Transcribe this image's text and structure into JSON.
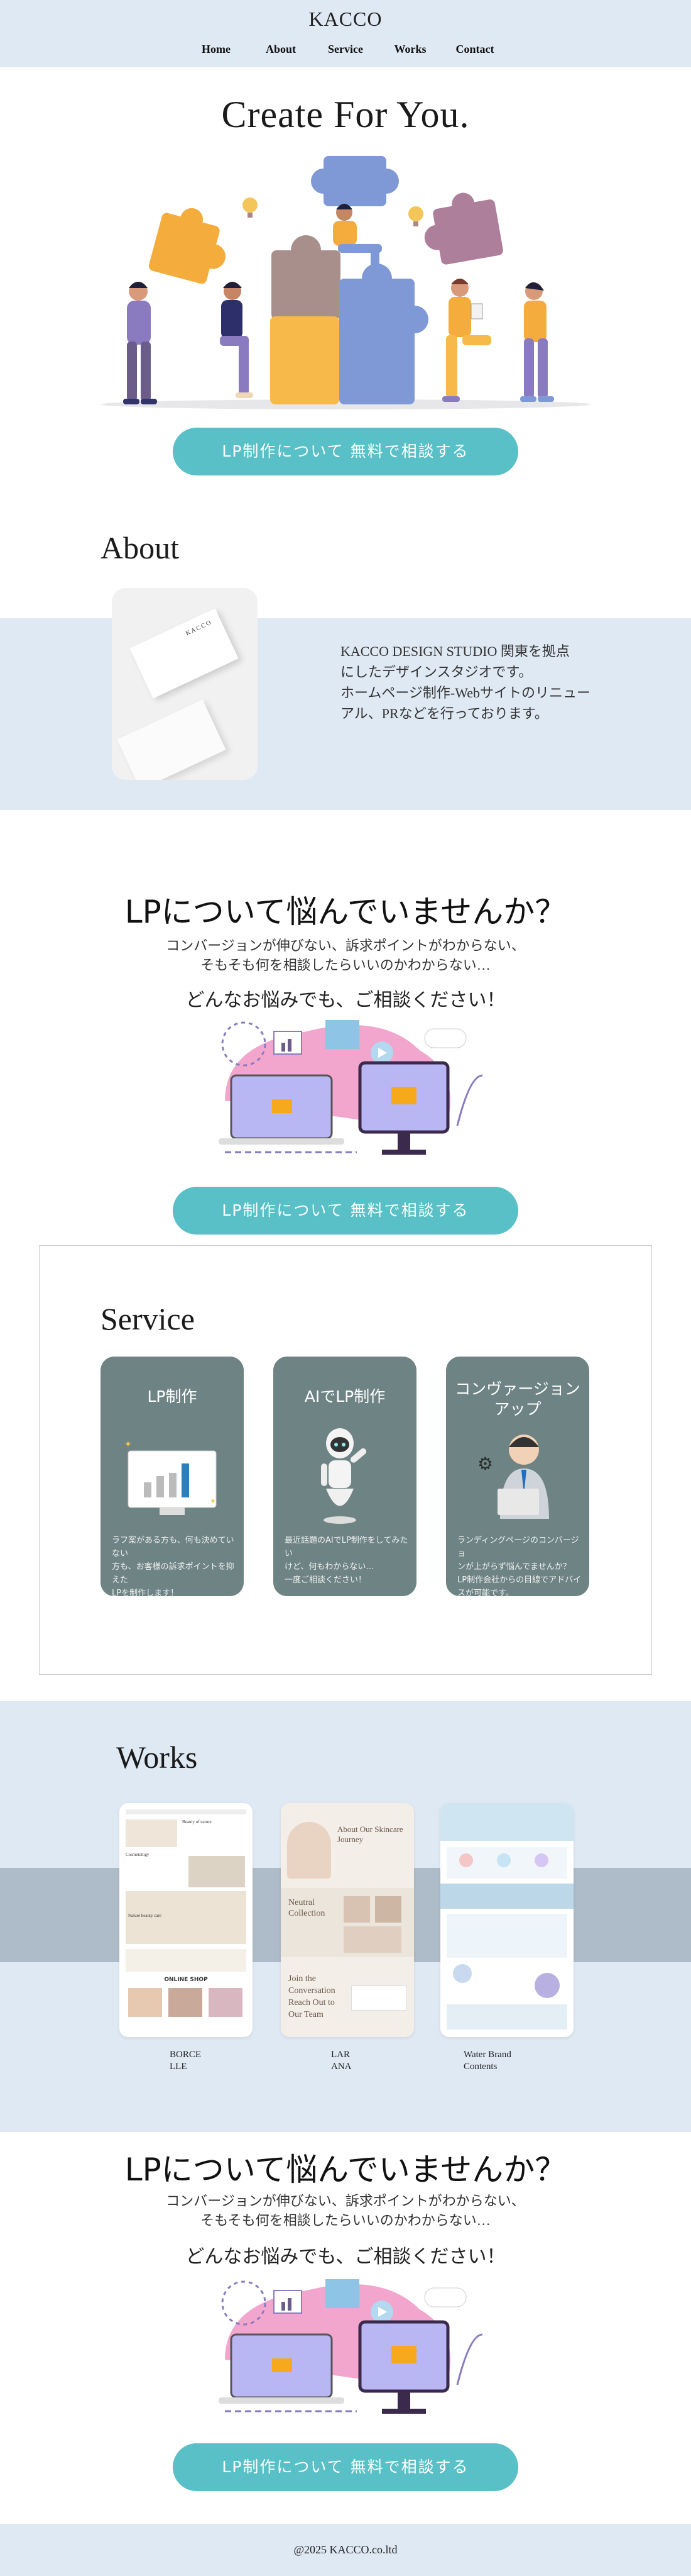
{
  "header": {
    "logo": "KACCO",
    "nav": [
      "Home",
      "About",
      "Service",
      "Works",
      "Contact"
    ]
  },
  "hero": {
    "title": "Create For You.",
    "cta": "LP制作について 無料で相談する"
  },
  "about": {
    "title": "About",
    "card_brand": "KACCO",
    "lines": [
      "KACCO DESIGN STUDIO 関東を拠点",
      "にしたデザインスタジオです。",
      "ホームページ制作-Webサイトのリニュー",
      "アル、PRなどを行っております。"
    ]
  },
  "lp_section": {
    "title": "LPについて悩んでいませんか？",
    "sub_lines": [
      "コンバージョンが伸びない、訴求ポイントがわからない、",
      "そもそも何を相談したらいいのかわからない…"
    ],
    "sub2": "どんなお悩みでも、ご相談ください！",
    "cta": "LP制作について 無料で相談する"
  },
  "service": {
    "title": "Service",
    "cards": [
      {
        "title_lines": [
          "LP制作"
        ],
        "desc_lines": [
          "ラフ案がある方も、何も決めていない",
          "方も、お客様の訴求ポイントを抑えた",
          "LPを制作します！"
        ]
      },
      {
        "title_lines": [
          "AIでLP制作"
        ],
        "desc_lines": [
          "最近話題のAIでLP制作をしてみたい",
          "けど、何もわからない…",
          "一度ご相談ください！"
        ]
      },
      {
        "title_lines": [
          "コンヴァージョン",
          "アップ"
        ],
        "desc_lines": [
          "ランディングページのコンバージョ",
          "ンが上がらず悩んでませんか？",
          "LP制作会社からの目線でアドバイ",
          "スが可能です。"
        ]
      }
    ]
  },
  "works": {
    "title": "Works",
    "items": [
      {
        "label_lines": [
          "BORCE",
          "LLE"
        ],
        "shop_label": "ONLINE SHOP",
        "mock_texts": [
          "Beauty of nature",
          "Cosmetology",
          "Nature beauty care"
        ]
      },
      {
        "label_lines": [
          "LAR",
          "ANA"
        ],
        "mock_texts": [
          "About Our Skincare Journey",
          "Neutral Collection",
          "Join the Conversation Reach Out to Our Team"
        ]
      },
      {
        "label_lines": [
          "Water Brand",
          "Contents"
        ],
        "mock_texts": []
      }
    ]
  },
  "lp_section2": {
    "title": "LPについて悩んでいませんか？",
    "sub_lines": [
      "コンバージョンが伸びない、訴求ポイントがわからない、",
      "そもそも何を相談したらいいのかわからない…"
    ],
    "sub2": "どんなお悩みでも、ご相談ください！",
    "cta": "LP制作について 無料で相談する"
  },
  "footer": {
    "copyright": "@2025 KACCO.co.ltd"
  },
  "colors": {
    "band": "#dfe9f4",
    "accent": "#58c0c6",
    "card": "#6e8384",
    "works_band": "#aebcc9"
  }
}
